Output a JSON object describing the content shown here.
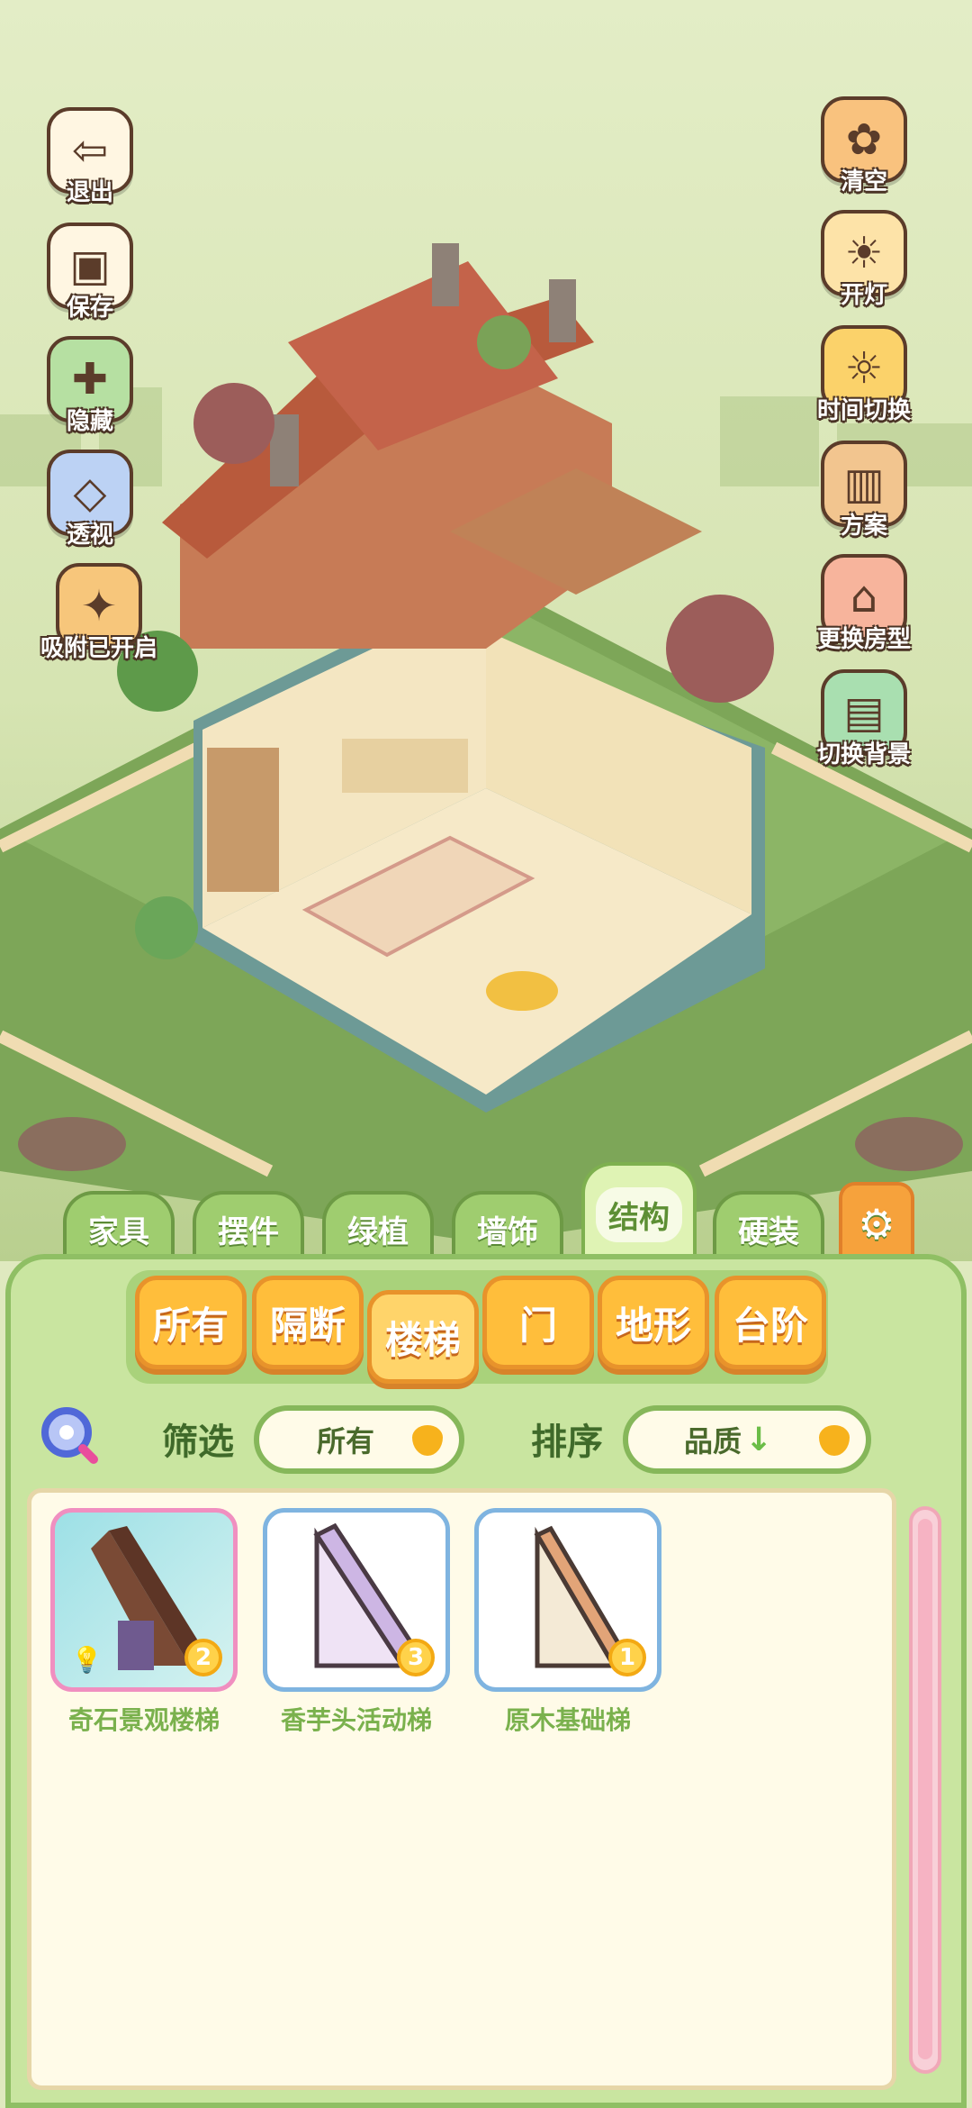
{
  "left_buttons": [
    {
      "label": "退出",
      "icon": "exit-icon"
    },
    {
      "label": "保存",
      "icon": "save-icon"
    },
    {
      "label": "隐藏",
      "icon": "hide-icon"
    },
    {
      "label": "透视",
      "icon": "perspective-icon"
    },
    {
      "label": "吸附已开启",
      "icon": "snap-icon"
    }
  ],
  "right_buttons": [
    {
      "label": "清空",
      "icon": "clear-icon"
    },
    {
      "label": "开灯",
      "icon": "light-icon"
    },
    {
      "label": "时间切换",
      "icon": "time-switch-icon"
    },
    {
      "label": "方案",
      "icon": "plan-icon"
    },
    {
      "label": "更换房型",
      "icon": "change-house-icon"
    },
    {
      "label": "切换背景",
      "icon": "switch-background-icon"
    }
  ],
  "category_tabs": [
    "家具",
    "摆件",
    "绿植",
    "墙饰",
    "结构",
    "硬装"
  ],
  "active_category": "结构",
  "sub_tabs": [
    "所有",
    "隔断",
    "楼梯",
    "门",
    "地形",
    "台阶"
  ],
  "active_sub_tab": "楼梯",
  "filter": {
    "label": "筛选",
    "value": "所有"
  },
  "sort": {
    "label": "排序",
    "value": "品质",
    "direction_icon": "arrow-down-icon"
  },
  "items": [
    {
      "name": "奇石景观楼梯",
      "count": "2",
      "rarity": "rare"
    },
    {
      "name": "香芋头活动梯",
      "count": "3",
      "rarity": "common"
    },
    {
      "name": "原木基础梯",
      "count": "1",
      "rarity": "common"
    }
  ],
  "colors": {
    "panel": "#c9e5a0",
    "tab_active": "#dff3b4",
    "subtab": "#ffbe3b",
    "item_text": "#7ab14d"
  }
}
